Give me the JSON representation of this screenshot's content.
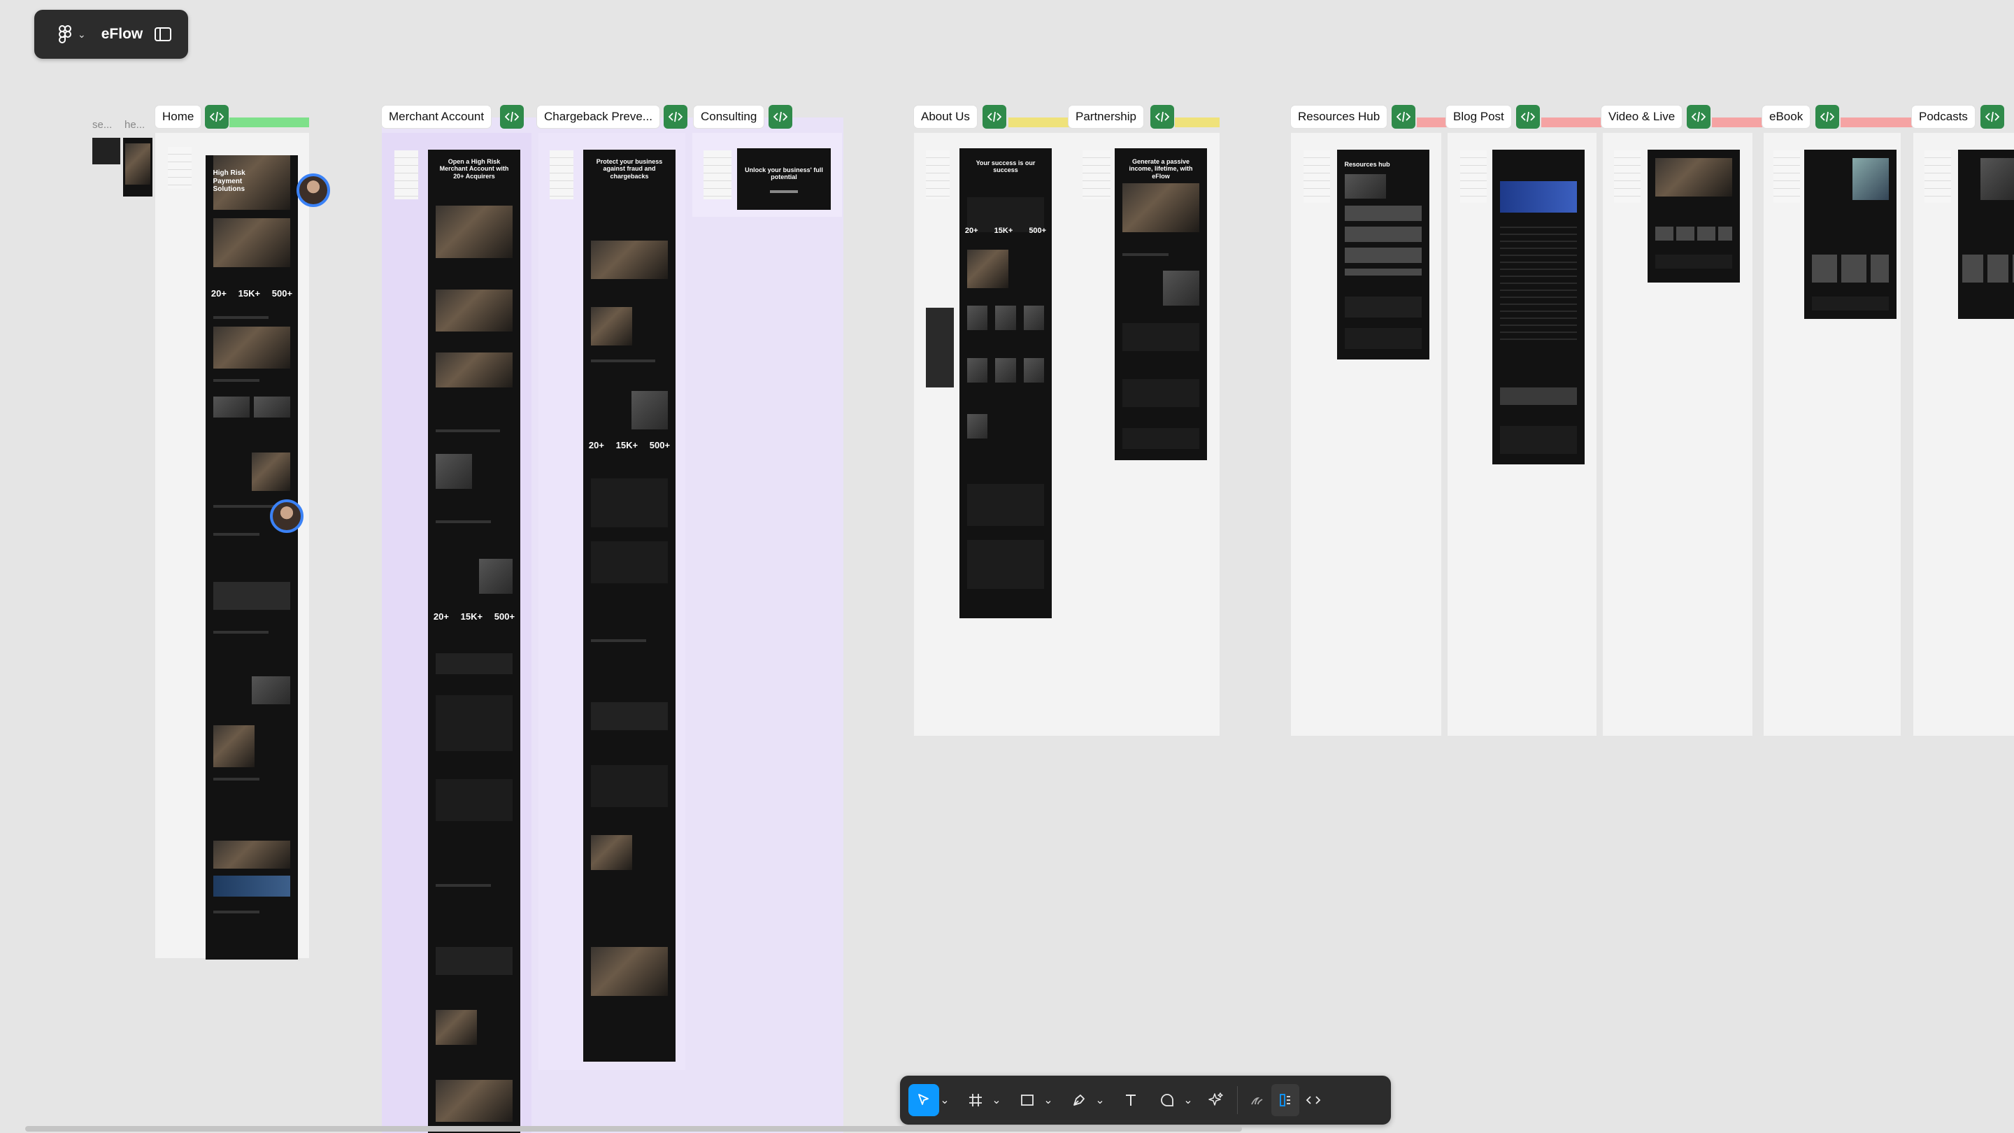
{
  "app": {
    "file_name": "eFlow"
  },
  "sections": [
    {
      "label": "Home",
      "status_color": "#7ee08a"
    },
    {
      "label": "Merchant Account",
      "status_color": "#cfc1f7"
    },
    {
      "label": "Chargeback Preve...",
      "status_color": "#cfc1f7"
    },
    {
      "label": "Consulting",
      "status_color": "#cfc1f7"
    },
    {
      "label": "About Us",
      "status_color": "#efe27a"
    },
    {
      "label": "Partnership",
      "status_color": "#efe27a"
    },
    {
      "label": "Resources Hub",
      "status_color": "#f5a3a3"
    },
    {
      "label": "Blog Post",
      "status_color": "#f5a3a3"
    },
    {
      "label": "Video & Live",
      "status_color": "#f5a3a3"
    },
    {
      "label": "eBook",
      "status_color": "#f5a3a3"
    },
    {
      "label": "Podcasts",
      "status_color": "#f5a3a3"
    }
  ],
  "small_labels": [
    "se...",
    "he..."
  ],
  "frame_text": {
    "home_hero": "High Risk Payment Solutions",
    "stats": [
      "20+",
      "15K+",
      "500+"
    ],
    "merchant_hero": "Open a High Risk Merchant Account with 20+ Acquirers",
    "chargeback_hero": "Protect your business against fraud and chargebacks",
    "consulting_hero": "Unlock your business' full potential",
    "about_hero": "Your success is our success",
    "partnership_hero": "Generate a passive income, lifetime, with eFlow",
    "resources_hero": "Resources hub"
  },
  "toolbar": {
    "tools": [
      "move-tool",
      "frame-tool",
      "shape-tool",
      "pen-tool",
      "text-tool",
      "comment-tool",
      "actions-tool",
      "draw-mode",
      "design-mode",
      "dev-mode"
    ]
  },
  "colors": {
    "canvas": "#e5e5e5",
    "code_button": "#2f8a4a",
    "active_tool": "#0d99ff",
    "frame_dark": "#121212"
  }
}
